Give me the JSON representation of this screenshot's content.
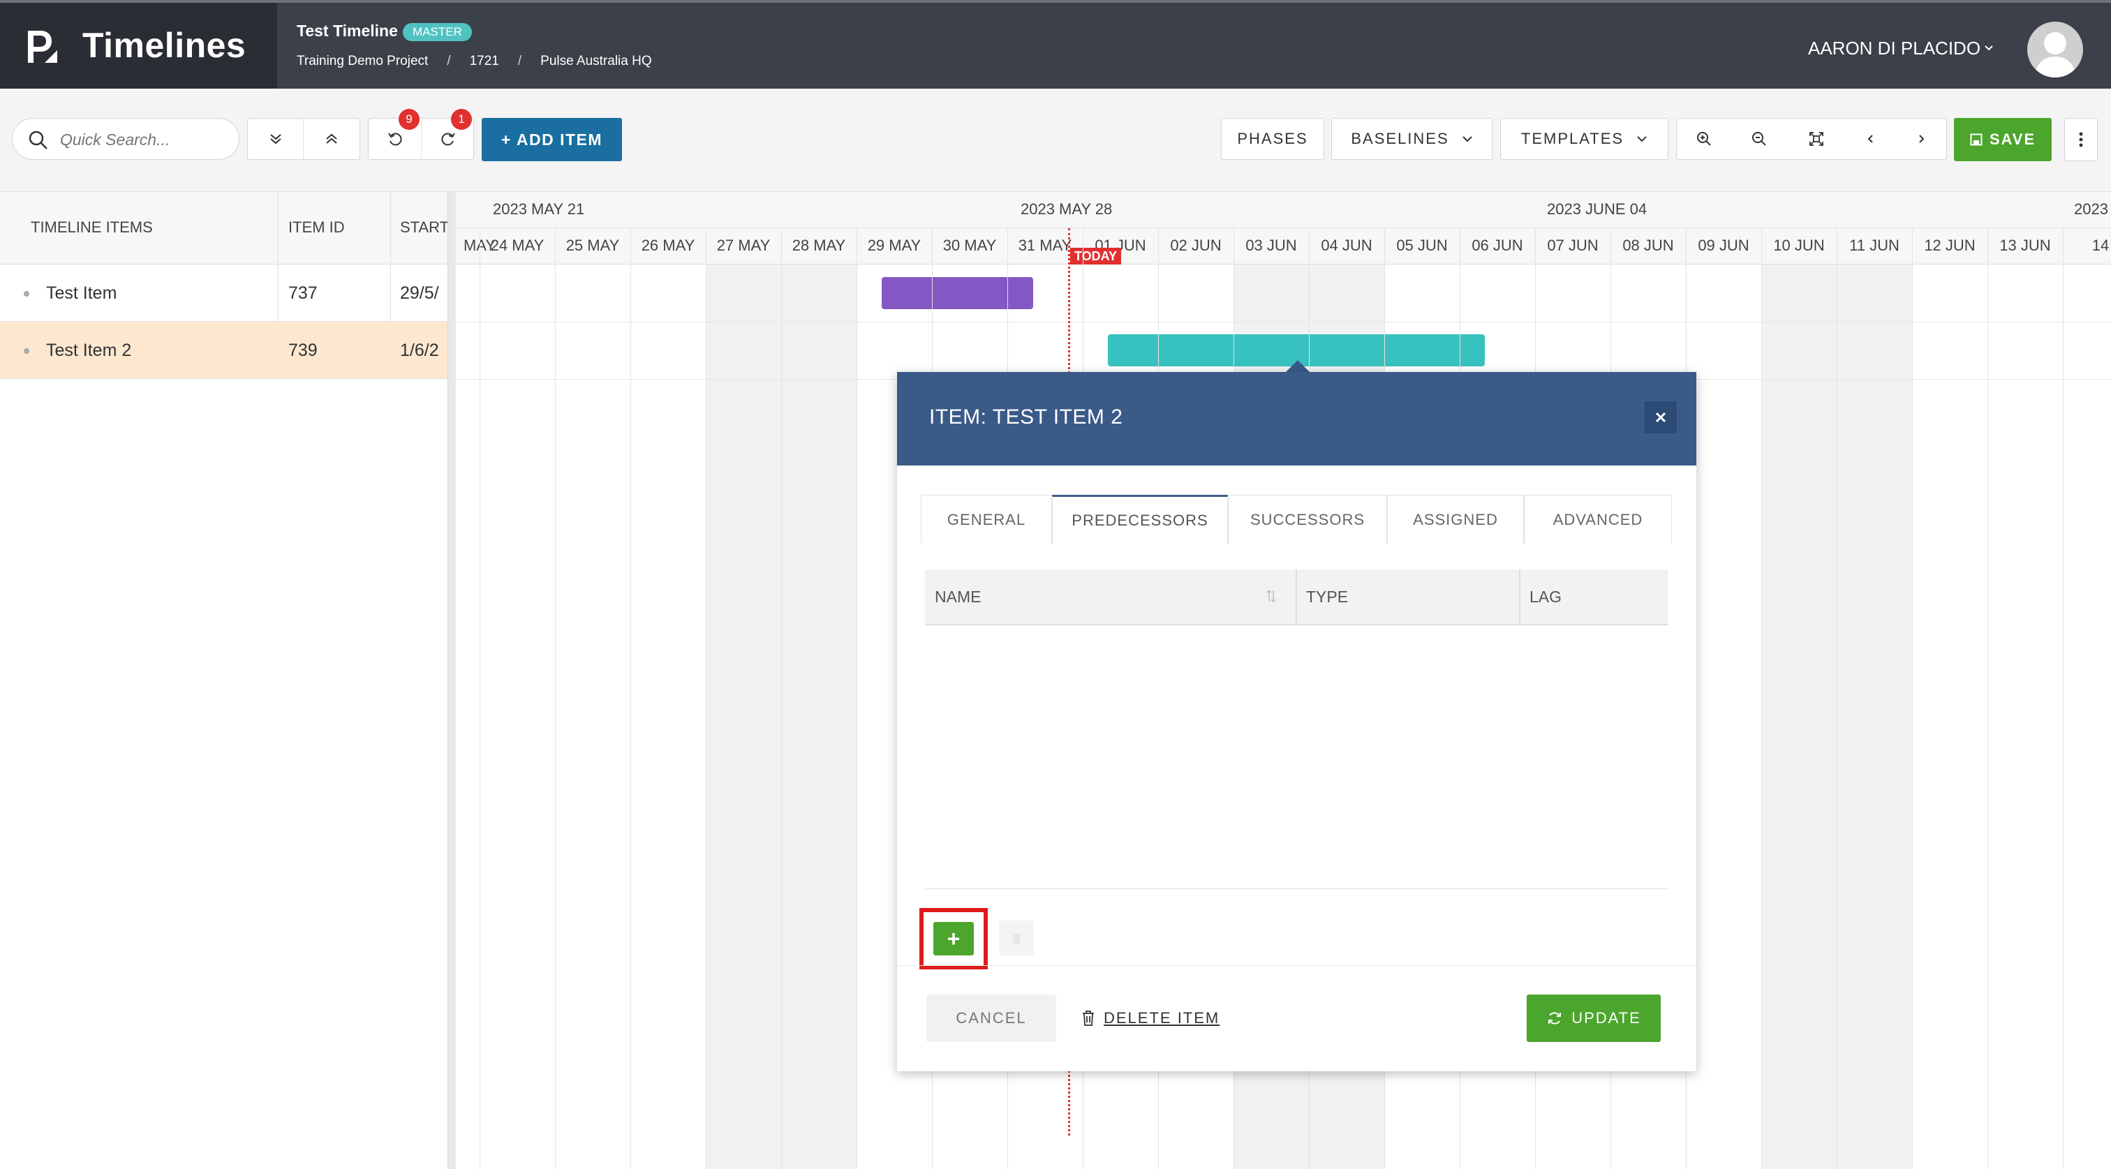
{
  "app": {
    "name": "Timelines"
  },
  "header": {
    "timeline_title": "Test Timeline",
    "badge": "MASTER",
    "breadcrumbs": [
      "Training Demo Project",
      "/",
      "1721",
      "/",
      "Pulse Australia HQ"
    ],
    "user_name": "AARON DI PLACIDO"
  },
  "toolbar": {
    "search_placeholder": "Quick Search...",
    "undo_count": "9",
    "redo_count": "1",
    "add_item_label": "+ ADD ITEM",
    "phases_label": "PHASES",
    "baselines_label": "BASELINES",
    "templates_label": "TEMPLATES",
    "save_label": "SAVE"
  },
  "grid": {
    "headers": {
      "items": "TIMELINE ITEMS",
      "id": "ITEM ID",
      "start": "START"
    },
    "rows": [
      {
        "name": "Test Item",
        "id": "737",
        "start": "29/5/",
        "selected": false
      },
      {
        "name": "Test Item 2",
        "id": "739",
        "start": "1/6/2",
        "selected": true
      }
    ]
  },
  "gantt": {
    "weeks": [
      "2023 MAY 21",
      "2023 MAY 28",
      "2023 JUNE 04",
      "2023"
    ],
    "days": [
      "MAY",
      "24 MAY",
      "25 MAY",
      "26 MAY",
      "27 MAY",
      "28 MAY",
      "29 MAY",
      "30 MAY",
      "31 MAY",
      "01 JUN",
      "02 JUN",
      "03 JUN",
      "04 JUN",
      "05 JUN",
      "06 JUN",
      "07 JUN",
      "08 JUN",
      "09 JUN",
      "10 JUN",
      "11 JUN",
      "12 JUN",
      "13 JUN",
      "14"
    ],
    "today_label": "TODAY",
    "bar_colors": {
      "test_item": "#8358c4",
      "test_item_2": "#37c2bf"
    }
  },
  "modal": {
    "title": "ITEM: TEST ITEM 2",
    "tabs": [
      "GENERAL",
      "PREDECESSORS",
      "SUCCESSORS",
      "ASSIGNED",
      "ADVANCED"
    ],
    "active_tab": "PREDECESSORS",
    "table_headers": {
      "name": "NAME",
      "type": "TYPE",
      "lag": "LAG"
    },
    "add_symbol": "+",
    "cancel_label": "CANCEL",
    "delete_label": "DELETE ITEM",
    "update_label": "UPDATE"
  },
  "colors": {
    "header_bg": "#3c4049",
    "primary_blue": "#1a6fa0",
    "success_green": "#4ca52d",
    "modal_header": "#3a5a88",
    "today_red": "#e0312f",
    "selected_row": "#fde7cf"
  }
}
